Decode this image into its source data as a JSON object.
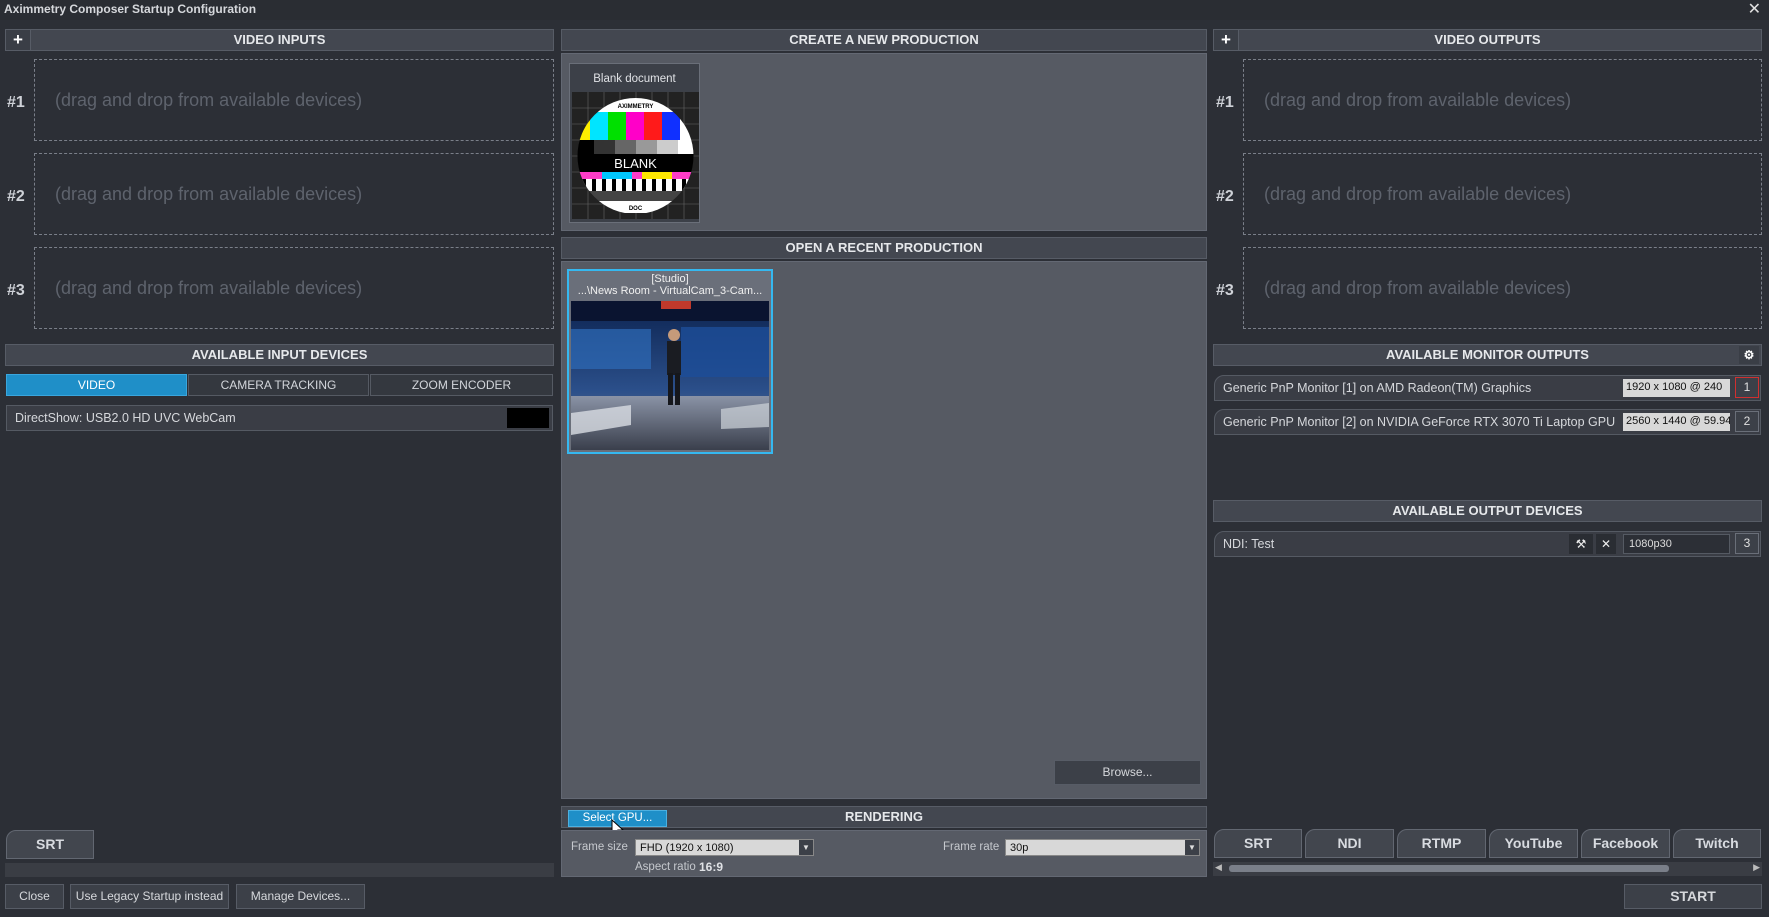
{
  "window": {
    "title": "Aximmetry Composer Startup Configuration",
    "close_glyph": "✕"
  },
  "video_inputs": {
    "title": "VIDEO INPUTS",
    "add": "+",
    "slots": [
      {
        "num": "#1",
        "placeholder": "(drag and drop from available devices)"
      },
      {
        "num": "#2",
        "placeholder": "(drag and drop from available devices)"
      },
      {
        "num": "#3",
        "placeholder": "(drag and drop from available devices)"
      }
    ]
  },
  "input_devices": {
    "title": "AVAILABLE INPUT DEVICES",
    "tabs": [
      "VIDEO",
      "CAMERA TRACKING",
      "ZOOM ENCODER"
    ],
    "active_tab": "VIDEO",
    "devices": [
      "DirectShow: USB2.0 HD UVC WebCam"
    ],
    "srt_tab": "SRT"
  },
  "create_production": {
    "title": "CREATE A NEW PRODUCTION",
    "blank_label": "Blank document",
    "logo_top": "AXIMMETRY",
    "logo_mid": "BLANK",
    "logo_bottom": "DOC"
  },
  "recent_production": {
    "title": "OPEN A RECENT PRODUCTION",
    "item_line1": "[Studio]",
    "item_line2": "...\\News Room - VirtualCam_3-Cam...",
    "browse": "Browse..."
  },
  "rendering": {
    "title": "RENDERING",
    "select_gpu": "Select GPU...",
    "frame_size_label": "Frame size",
    "frame_size": "FHD (1920 x 1080)",
    "frame_rate_label": "Frame rate",
    "frame_rate": "30p",
    "aspect_label": "Aspect ratio",
    "aspect_value": "16:9"
  },
  "video_outputs": {
    "title": "VIDEO OUTPUTS",
    "add": "+",
    "slots": [
      {
        "num": "#1",
        "placeholder": "(drag and drop from available devices)"
      },
      {
        "num": "#2",
        "placeholder": "(drag and drop from available devices)"
      },
      {
        "num": "#3",
        "placeholder": "(drag and drop from available devices)"
      }
    ]
  },
  "monitor_outputs": {
    "title": "AVAILABLE MONITOR OUTPUTS",
    "monitors": [
      {
        "name": "Generic PnP Monitor [1] on AMD Radeon(TM) Graphics",
        "mode": "1920 x 1080 @ 240",
        "num": "1"
      },
      {
        "name": "Generic PnP Monitor [2] on NVIDIA GeForce RTX 3070 Ti Laptop GPU",
        "mode": "2560 x 1440 @ 59.94",
        "num": "2"
      }
    ]
  },
  "output_devices": {
    "title": "AVAILABLE OUTPUT DEVICES",
    "devices": [
      {
        "name": "NDI: Test",
        "format": "1080p30",
        "num": "3"
      }
    ],
    "tabs": [
      "SRT",
      "NDI",
      "RTMP",
      "YouTube",
      "Facebook",
      "Twitch"
    ]
  },
  "footer": {
    "close": "Close",
    "legacy": "Use Legacy Startup instead",
    "manage": "Manage Devices...",
    "start": "START"
  },
  "colors": {
    "accent": "#1f8fc8",
    "panel": "#565a63",
    "background": "#2c2f36"
  }
}
